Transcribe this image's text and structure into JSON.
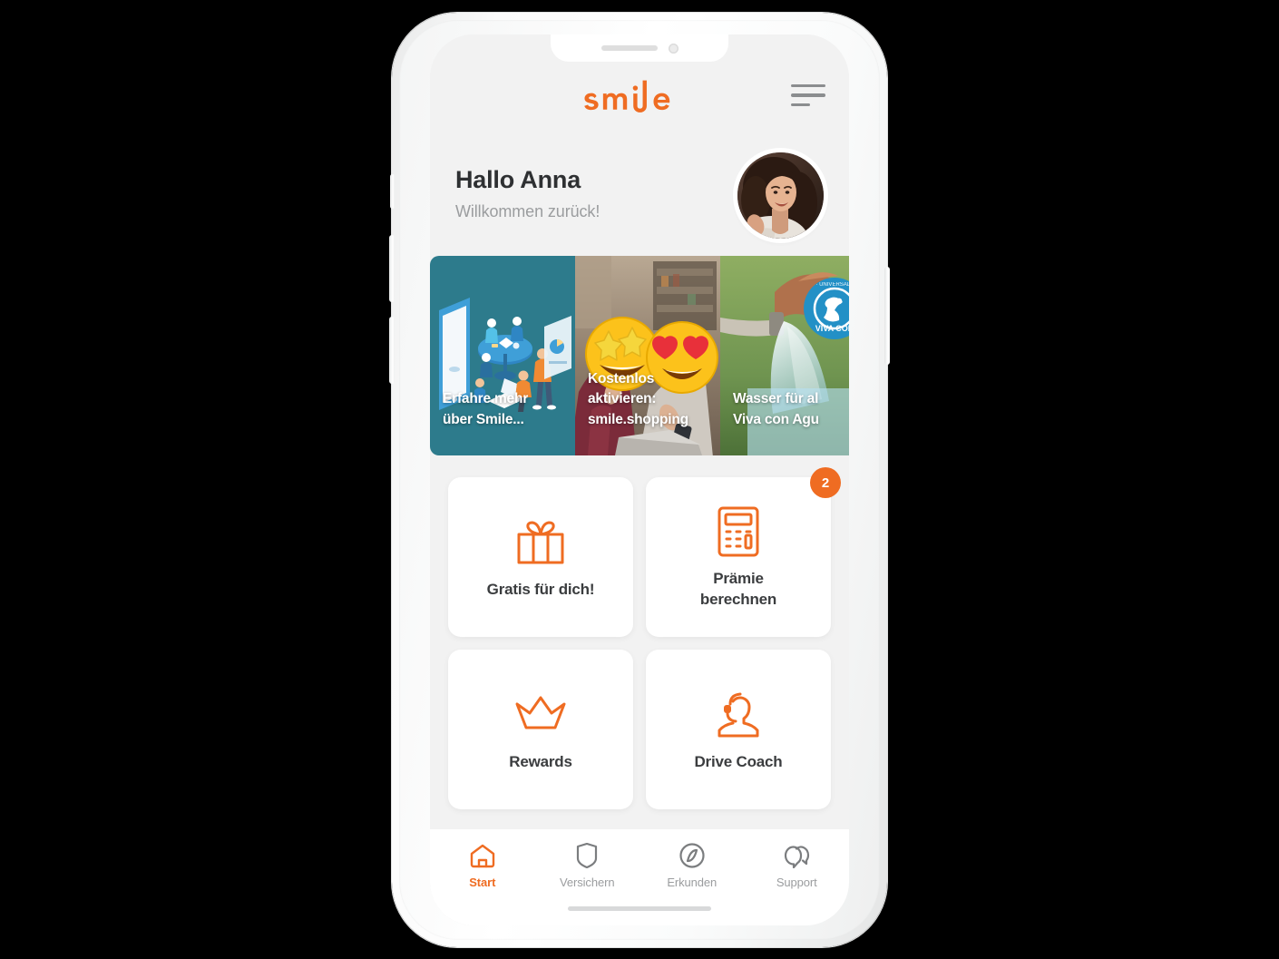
{
  "device": {
    "notch": {
      "speaker": "earpiece-speaker",
      "camera": "front-camera"
    },
    "buttons": [
      "mute-switch",
      "volume-up",
      "volume-down",
      "power-button"
    ]
  },
  "app": {
    "brand": "smile",
    "menu_label": "menu",
    "header": {
      "greeting": "Hallo Anna",
      "subtitle": "Willkommen zurück!",
      "avatar_alt": "Anna"
    },
    "carousel": [
      {
        "caption": "Erfahre mehr\nüber Smile...",
        "art": "isometric-team-illustration",
        "bg": "#2d7b8c"
      },
      {
        "caption": "Kostenlos\naktivieren:\nsmile.shopping",
        "art": "photo-two-people-emoji",
        "bg": "#6b5b50"
      },
      {
        "caption": "Wasser für al\nViva con Agu",
        "art": "photo-water-hose",
        "bg": "#7da05c"
      }
    ],
    "tiles": [
      {
        "label": "Gratis für dich!",
        "icon": "gift-icon",
        "badge": null
      },
      {
        "label": "Prämie\nberechnen",
        "icon": "calculator-icon",
        "badge": "2"
      },
      {
        "label": "Rewards",
        "icon": "crown-icon",
        "badge": null
      },
      {
        "label": "Drive Coach",
        "icon": "headset-person-icon",
        "badge": null
      }
    ],
    "nav": [
      {
        "label": "Start",
        "icon": "home-icon",
        "active": true
      },
      {
        "label": "Versichern",
        "icon": "shield-icon",
        "active": false
      },
      {
        "label": "Erkunden",
        "icon": "compass-icon",
        "active": false
      },
      {
        "label": "Support",
        "icon": "chat-bubbles-icon",
        "active": false
      }
    ]
  },
  "colors": {
    "brand_orange": "#ef6c22",
    "screen_bg": "#f2f2f2",
    "card_bg": "#ffffff",
    "text_dark": "#2e3032",
    "text_muted": "#9b9d9f",
    "teal_card": "#2d7b8c"
  }
}
